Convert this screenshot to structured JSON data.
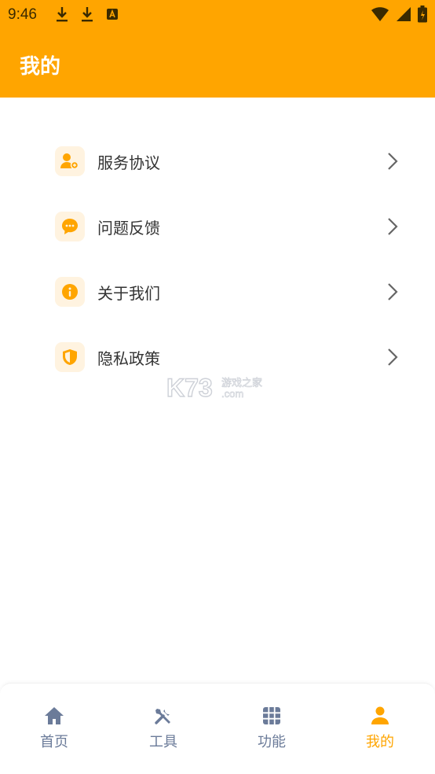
{
  "status_bar": {
    "time": "9:46",
    "left_icons": [
      "download-icon",
      "download-icon",
      "font-app-icon"
    ],
    "right_icons": [
      "wifi-icon",
      "signal-icon",
      "battery-icon"
    ]
  },
  "header": {
    "title": "我的",
    "background_color": "#ffa500"
  },
  "menu": {
    "items": [
      {
        "label": "服务协议",
        "icon": "user-agreement-icon"
      },
      {
        "label": "问题反馈",
        "icon": "chat-feedback-icon"
      },
      {
        "label": "关于我们",
        "icon": "info-icon"
      },
      {
        "label": "隐私政策",
        "icon": "shield-icon"
      }
    ],
    "icon_color": "#ffa500",
    "icon_bg_color": "#fff3e0"
  },
  "watermark": {
    "brand": "K73",
    "text": "游戏之家",
    "domain": ".com"
  },
  "bottom_nav": {
    "items": [
      {
        "label": "首页",
        "icon": "home-icon",
        "active": false
      },
      {
        "label": "工具",
        "icon": "tools-icon",
        "active": false
      },
      {
        "label": "功能",
        "icon": "grid-icon",
        "active": false
      },
      {
        "label": "我的",
        "icon": "person-icon",
        "active": true
      }
    ],
    "active_color": "#ffa500",
    "inactive_color": "#6b7b99"
  }
}
